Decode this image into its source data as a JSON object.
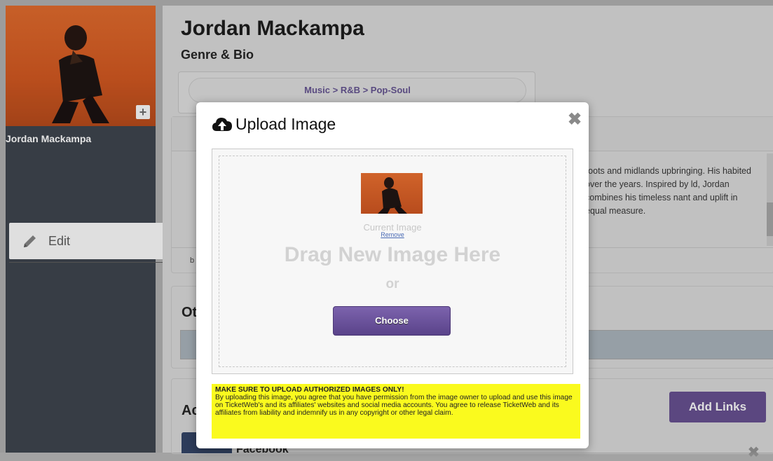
{
  "sidebar": {
    "artist_name": "Jordan Mackampa",
    "photo_add_glyph": "+",
    "nav": [
      {
        "label": "Edit",
        "icon": "pencil-icon"
      }
    ]
  },
  "main": {
    "page_title": "Jordan Mackampa",
    "genre_section_title": "Genre & Bio",
    "genre_path": "Music > R&B > Pop-Soul",
    "bio_text": "roots and midlands upbringing. His habited over the years. Inspired by ld, Jordan combines his timeless nant and uplift in equal measure.",
    "bio_status": "b",
    "other_title": "Ot",
    "links_title": "Ac",
    "add_links_label": "Add Links",
    "facebook_label": "Facebook",
    "facebook_remove_glyph": "✖"
  },
  "modal": {
    "title": "Upload Image",
    "title_icon": "cloud-upload-icon",
    "close_glyph": "✖",
    "current_image_label": "Current Image",
    "remove_label": "Remove",
    "drag_text": "Drag New Image Here",
    "or_text": "or",
    "choose_label": "Choose",
    "disclaimer_heading": "MAKE SURE TO UPLOAD AUTHORIZED IMAGES ONLY!",
    "disclaimer_body": "By uploading this image, you agree that you have permission from the image owner to upload and use this image on TicketWeb's and its affiliates' websites and social media accounts. You agree to release TicketWeb and its affiliates from liability and indemnify us in any copyright or other legal claim."
  },
  "colors": {
    "accent_purple": "#5f4a86",
    "disclaimer_yellow": "#fafa1e",
    "sidebar_dark": "#3a4048"
  }
}
